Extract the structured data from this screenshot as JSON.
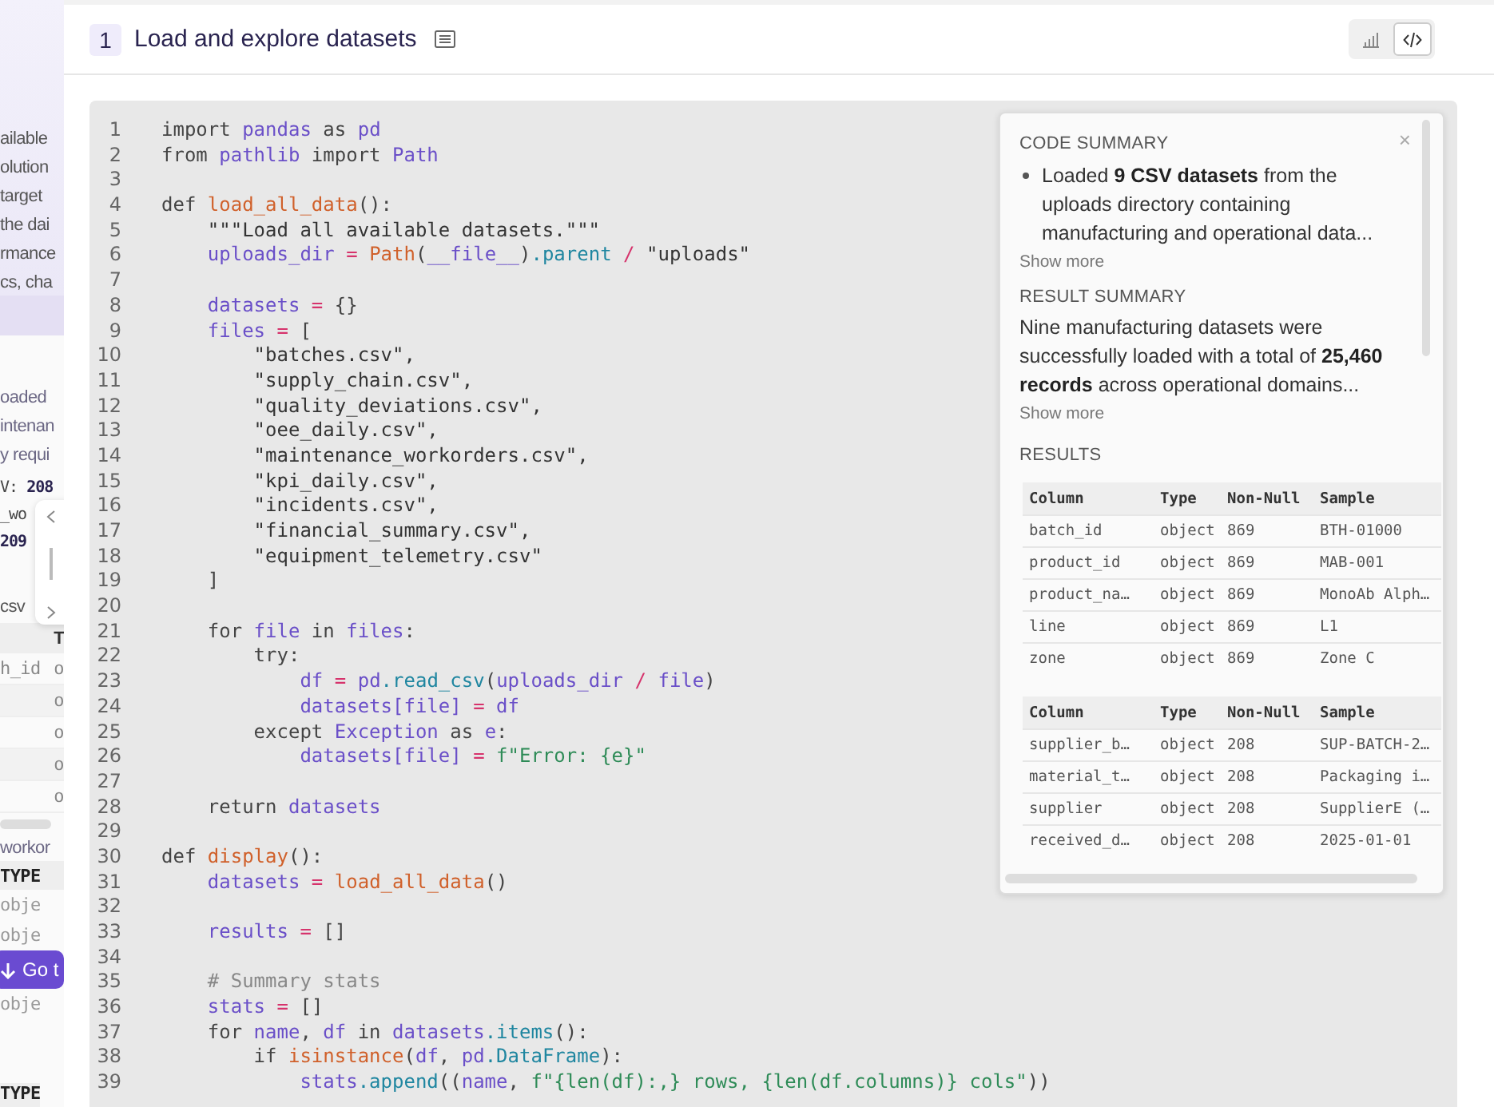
{
  "background_page": {
    "intro_lines": [
      "ailable",
      "olution",
      "target",
      "the dai",
      "rmance",
      "cs, cha"
    ],
    "notes": [
      "oaded",
      "intenan",
      "y requi"
    ],
    "stat_lines": [
      "V: **208**",
      "_wo",
      "**209**"
    ],
    "file_label": "csv",
    "table_1": {
      "header": "T",
      "rows": [
        {
          "cells": [
            "h_id",
            "o"
          ]
        },
        {
          "cells": [
            "o"
          ]
        },
        {
          "cells": [
            "o"
          ]
        },
        {
          "cells": [
            "o"
          ]
        },
        {
          "cells": [
            "o"
          ]
        }
      ]
    },
    "file_label_2": "workor",
    "table_2": {
      "header": "TYPE",
      "rows": [
        "obje",
        "obje",
        "obje"
      ]
    },
    "go_button": "Go t",
    "table_3": {
      "header": "TYPE"
    }
  },
  "cell": {
    "number": "1",
    "title": "Load and explore datasets",
    "views": [
      {
        "kind": "chart",
        "selected": false
      },
      {
        "kind": "code",
        "selected": true
      }
    ]
  },
  "code_lines": [
    {
      "n": "1",
      "tokens": [
        {
          "t": "import ",
          "kind": "keyword"
        },
        {
          "t": "pandas",
          "kind": "variable"
        },
        {
          "t": " as ",
          "kind": "keyword"
        },
        {
          "t": "pd",
          "kind": "variable"
        }
      ]
    },
    {
      "n": "2",
      "tokens": [
        {
          "t": "from ",
          "kind": "keyword"
        },
        {
          "t": "pathlib",
          "kind": "variable"
        },
        {
          "t": " import ",
          "kind": "keyword"
        },
        {
          "t": "Path",
          "kind": "variable"
        }
      ]
    },
    {
      "n": "3"
    },
    {
      "n": "4",
      "tokens": [
        {
          "t": "def ",
          "kind": "keyword"
        },
        {
          "t": "load_all_data",
          "kind": "function"
        },
        {
          "t": "():",
          "kind": "keyword"
        }
      ]
    },
    {
      "n": "5",
      "tokens": [
        {
          "t": "    \"\"\"Load all available datasets.\"\"\"",
          "kind": "string"
        }
      ]
    },
    {
      "n": "6",
      "tokens": [
        {
          "t": "    uploads_dir",
          "kind": "variable"
        },
        {
          "t": " = ",
          "kind": "operator"
        },
        {
          "t": "Path",
          "kind": "function"
        },
        {
          "t": "(",
          "kind": "keyword"
        },
        {
          "t": "__file__",
          "kind": "variable"
        },
        {
          "t": ")",
          "kind": "keyword"
        },
        {
          "t": ".parent",
          "kind": "attribute"
        },
        {
          "t": " / ",
          "kind": "operator"
        },
        {
          "t": "\"uploads\"",
          "kind": "string"
        }
      ]
    },
    {
      "n": "7"
    },
    {
      "n": "8",
      "tokens": [
        {
          "t": "    datasets",
          "kind": "variable"
        },
        {
          "t": " = ",
          "kind": "operator"
        },
        {
          "t": "{}",
          "kind": "keyword"
        }
      ]
    },
    {
      "n": "9",
      "tokens": [
        {
          "t": "    files",
          "kind": "variable"
        },
        {
          "t": " = ",
          "kind": "operator"
        },
        {
          "t": "[",
          "kind": "keyword"
        }
      ]
    },
    {
      "n": "10",
      "tokens": [
        {
          "t": "        \"batches.csv\",",
          "kind": "string"
        }
      ]
    },
    {
      "n": "11",
      "tokens": [
        {
          "t": "        \"supply_chain.csv\",",
          "kind": "string"
        }
      ]
    },
    {
      "n": "12",
      "tokens": [
        {
          "t": "        \"quality_deviations.csv\",",
          "kind": "string"
        }
      ]
    },
    {
      "n": "13",
      "tokens": [
        {
          "t": "        \"oee_daily.csv\",",
          "kind": "string"
        }
      ]
    },
    {
      "n": "14",
      "tokens": [
        {
          "t": "        \"maintenance_workorders.csv\",",
          "kind": "string"
        }
      ]
    },
    {
      "n": "15",
      "tokens": [
        {
          "t": "        \"kpi_daily.csv\",",
          "kind": "string"
        }
      ]
    },
    {
      "n": "16",
      "tokens": [
        {
          "t": "        \"incidents.csv\",",
          "kind": "string"
        }
      ]
    },
    {
      "n": "17",
      "tokens": [
        {
          "t": "        \"financial_summary.csv\",",
          "kind": "string"
        }
      ]
    },
    {
      "n": "18",
      "tokens": [
        {
          "t": "        \"equipment_telemetry.csv\"",
          "kind": "string"
        }
      ]
    },
    {
      "n": "19",
      "tokens": [
        {
          "t": "    ]",
          "kind": "keyword"
        }
      ]
    },
    {
      "n": "20"
    },
    {
      "n": "21",
      "tokens": [
        {
          "t": "    for ",
          "kind": "keyword"
        },
        {
          "t": "file",
          "kind": "variable"
        },
        {
          "t": " in ",
          "kind": "keyword"
        },
        {
          "t": "files",
          "kind": "variable"
        },
        {
          "t": ":",
          "kind": "keyword"
        }
      ]
    },
    {
      "n": "22",
      "tokens": [
        {
          "t": "        try:",
          "kind": "keyword"
        }
      ]
    },
    {
      "n": "23",
      "tokens": [
        {
          "t": "            df",
          "kind": "variable"
        },
        {
          "t": " = ",
          "kind": "operator"
        },
        {
          "t": "pd",
          "kind": "variable"
        },
        {
          "t": ".read_csv",
          "kind": "attribute"
        },
        {
          "t": "(",
          "kind": "keyword"
        },
        {
          "t": "uploads_dir",
          "kind": "variable"
        },
        {
          "t": " / ",
          "kind": "operator"
        },
        {
          "t": "file",
          "kind": "variable"
        },
        {
          "t": ")",
          "kind": "keyword"
        }
      ]
    },
    {
      "n": "24",
      "tokens": [
        {
          "t": "            datasets[file]",
          "kind": "variable"
        },
        {
          "t": " = ",
          "kind": "operator"
        },
        {
          "t": "df",
          "kind": "variable"
        }
      ]
    },
    {
      "n": "25",
      "tokens": [
        {
          "t": "        except ",
          "kind": "keyword"
        },
        {
          "t": "Exception",
          "kind": "variable"
        },
        {
          "t": " as ",
          "kind": "keyword"
        },
        {
          "t": "e",
          "kind": "variable"
        },
        {
          "t": ":",
          "kind": "keyword"
        }
      ]
    },
    {
      "n": "26",
      "tokens": [
        {
          "t": "            datasets[file]",
          "kind": "variable"
        },
        {
          "t": " = ",
          "kind": "operator"
        },
        {
          "t": "f\"Error: {e}\"",
          "kind": "fstring"
        }
      ]
    },
    {
      "n": "27"
    },
    {
      "n": "28",
      "tokens": [
        {
          "t": "    return ",
          "kind": "keyword"
        },
        {
          "t": "datasets",
          "kind": "variable"
        }
      ]
    },
    {
      "n": "29"
    },
    {
      "n": "30",
      "tokens": [
        {
          "t": "def ",
          "kind": "keyword"
        },
        {
          "t": "display",
          "kind": "function"
        },
        {
          "t": "():",
          "kind": "keyword"
        }
      ]
    },
    {
      "n": "31",
      "tokens": [
        {
          "t": "    datasets",
          "kind": "variable"
        },
        {
          "t": " = ",
          "kind": "operator"
        },
        {
          "t": "load_all_data",
          "kind": "function"
        },
        {
          "t": "()",
          "kind": "keyword"
        }
      ]
    },
    {
      "n": "32"
    },
    {
      "n": "33",
      "tokens": [
        {
          "t": "    results",
          "kind": "variable"
        },
        {
          "t": " = ",
          "kind": "operator"
        },
        {
          "t": "[]",
          "kind": "keyword"
        }
      ]
    },
    {
      "n": "34"
    },
    {
      "n": "35",
      "tokens": [
        {
          "t": "    # Summary stats",
          "kind": "comment"
        }
      ]
    },
    {
      "n": "36",
      "tokens": [
        {
          "t": "    stats",
          "kind": "variable"
        },
        {
          "t": " = ",
          "kind": "operator"
        },
        {
          "t": "[]",
          "kind": "keyword"
        }
      ]
    },
    {
      "n": "37",
      "tokens": [
        {
          "t": "    for ",
          "kind": "keyword"
        },
        {
          "t": "name",
          "kind": "variable"
        },
        {
          "t": ", ",
          "kind": "keyword"
        },
        {
          "t": "df",
          "kind": "variable"
        },
        {
          "t": " in ",
          "kind": "keyword"
        },
        {
          "t": "datasets",
          "kind": "variable"
        },
        {
          "t": ".items",
          "kind": "attribute"
        },
        {
          "t": "():",
          "kind": "keyword"
        }
      ]
    },
    {
      "n": "38",
      "tokens": [
        {
          "t": "        if ",
          "kind": "keyword"
        },
        {
          "t": "isinstance",
          "kind": "function"
        },
        {
          "t": "(",
          "kind": "keyword"
        },
        {
          "t": "df",
          "kind": "variable"
        },
        {
          "t": ", ",
          "kind": "keyword"
        },
        {
          "t": "pd",
          "kind": "variable"
        },
        {
          "t": ".DataFrame",
          "kind": "attribute"
        },
        {
          "t": "):",
          "kind": "keyword"
        }
      ]
    },
    {
      "n": "39",
      "tokens": [
        {
          "t": "            stats",
          "kind": "variable"
        },
        {
          "t": ".append",
          "kind": "attribute"
        },
        {
          "t": "((",
          "kind": "keyword"
        },
        {
          "t": "name",
          "kind": "variable"
        },
        {
          "t": ", ",
          "kind": "keyword"
        },
        {
          "t": "f\"{len(df):,} rows, {len(df.columns)} cols\"",
          "kind": "fstring"
        },
        {
          "t": "))",
          "kind": "keyword"
        }
      ]
    }
  ],
  "summary_panel": {
    "close": "×",
    "code_summary": {
      "heading": "CODE SUMMARY",
      "bullets": [
        "Loaded **9 CSV datasets** from the uploads directory containing manufacturing and operational data..."
      ],
      "show_more": "Show more"
    },
    "result_summary": {
      "heading": "RESULT SUMMARY",
      "text": "Nine manufacturing datasets were successfully loaded with a total of **25,460 records** across operational domains...",
      "show_more": "Show more"
    },
    "results": {
      "heading": "RESULTS",
      "tables": [
        {
          "columns": [
            "Column",
            "Type",
            "Non-Null",
            "Sample"
          ],
          "rows": [
            [
              "batch_id",
              "object",
              "869",
              "BTH-01000"
            ],
            [
              "product_id",
              "object",
              "869",
              "MAB-001"
            ],
            [
              "product_na…",
              "object",
              "869",
              "MonoAb Alph…"
            ],
            [
              "line",
              "object",
              "869",
              "L1"
            ],
            [
              "zone",
              "object",
              "869",
              "Zone C"
            ]
          ]
        },
        {
          "columns": [
            "Column",
            "Type",
            "Non-Null",
            "Sample"
          ],
          "rows": [
            [
              "supplier_b…",
              "object",
              "208",
              "SUP-BATCH-2…"
            ],
            [
              "material_t…",
              "object",
              "208",
              "Packaging i…"
            ],
            [
              "supplier",
              "object",
              "208",
              "SupplierE (…"
            ],
            [
              "received_d…",
              "object",
              "208",
              "2025-01-01"
            ]
          ]
        }
      ]
    }
  }
}
